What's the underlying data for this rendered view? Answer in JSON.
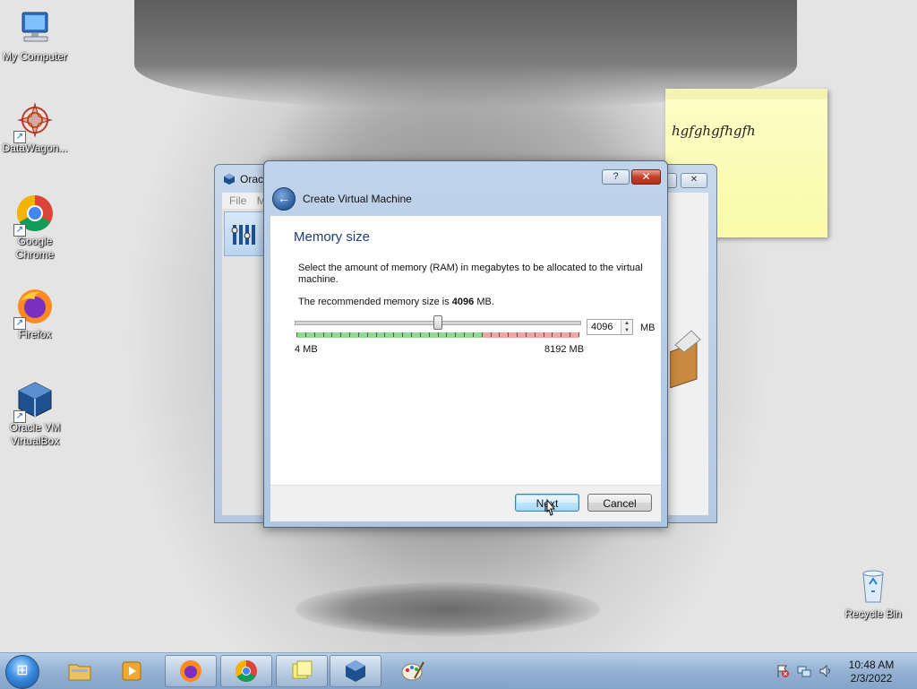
{
  "desktop": {
    "icons": [
      {
        "label": "My Computer",
        "icon": "computer-icon"
      },
      {
        "label": "DataWagon...",
        "icon": "datawagon-icon"
      },
      {
        "label": "Google Chrome",
        "icon": "chrome-icon"
      },
      {
        "label": "Firefox",
        "icon": "firefox-icon"
      },
      {
        "label": "Oracle VM VirtualBox",
        "icon": "virtualbox-icon"
      },
      {
        "label": "Recycle Bin",
        "icon": "recycle-bin-icon"
      }
    ]
  },
  "sticky_note": {
    "text": "hgfghgfhgfh"
  },
  "vbox_manager": {
    "title": "Orac",
    "menu": [
      "File",
      "M"
    ],
    "close_label": "✕",
    "restore_label": ""
  },
  "wizard": {
    "help_label": "?",
    "close_label": "✕",
    "title": "Create Virtual Machine",
    "heading": "Memory size",
    "description": "Select the amount of memory (RAM) in megabytes to be allocated to the virtual machine.",
    "recommended_prefix": "The recommended memory size is ",
    "recommended_value": "4096",
    "recommended_suffix": " MB.",
    "slider": {
      "min": 4,
      "max": 8192,
      "value": 4096,
      "min_label": "4 MB",
      "max_label": "8192 MB",
      "safe_fraction": 0.66
    },
    "spin_value": "4096",
    "unit": "MB",
    "next_label": "Next",
    "cancel_label": "Cancel"
  },
  "taskbar": {
    "items": [
      {
        "name": "explorer",
        "icon": "folder-icon"
      },
      {
        "name": "media-player",
        "icon": "media-player-icon"
      },
      {
        "name": "firefox",
        "icon": "firefox-icon"
      },
      {
        "name": "chrome",
        "icon": "chrome-icon"
      },
      {
        "name": "sticky-notes",
        "icon": "sticky-notes-icon"
      },
      {
        "name": "virtualbox",
        "icon": "virtualbox-icon"
      },
      {
        "name": "paint",
        "icon": "paint-icon"
      }
    ],
    "time": "10:48 AM",
    "date": "2/3/2022"
  },
  "colors": {
    "accent": "#1e3c7b",
    "safe_zone": "#8fdc8f",
    "warn_zone": "#f5a3a3"
  }
}
